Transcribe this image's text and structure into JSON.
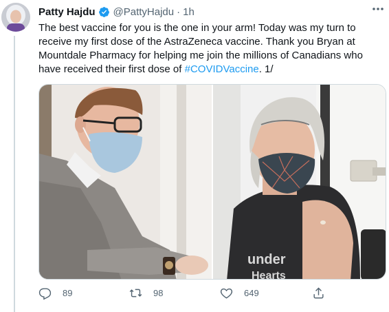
{
  "author": {
    "name": "Patty Hajdu",
    "handle": "@PattyHajdu",
    "separator": "·",
    "time": "1h"
  },
  "tweet": {
    "text_main": "The best vaccine for you is the one in your arm! Today was my turn to receive my first dose of the AstraZeneca vaccine. Thank you Bryan at Mountdale Pharmacy for helping me join the millions of Canadians who have received their first dose of ",
    "hashtag": "#COVIDVaccine",
    "text_end": ". 1/"
  },
  "actions": {
    "reply_count": "89",
    "retweet_count": "98",
    "like_count": "649"
  },
  "colors": {
    "accent": "#1d9bf0",
    "verified": "#1d9bf0",
    "muted": "#536471"
  },
  "icons": {
    "verified": "verified-badge-icon",
    "more": "more-horizontal-icon",
    "reply": "reply-icon",
    "retweet": "retweet-icon",
    "like": "heart-icon",
    "share": "share-icon"
  }
}
